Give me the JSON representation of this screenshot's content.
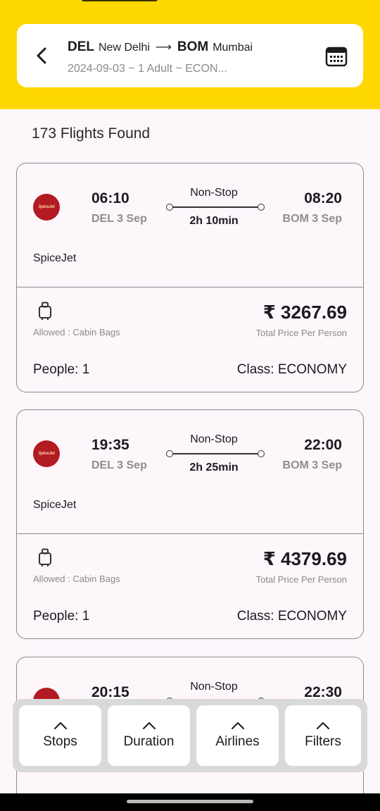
{
  "header": {
    "from_code": "DEL",
    "from_city": "New Delhi",
    "arrow": "⟶",
    "to_code": "BOM",
    "to_city": "Mumbai",
    "subtitle": "2024-09-03 ~ 1 Adult ~ ECON...",
    "back_icon": "chevron-left-icon",
    "calendar_icon": "calendar-icon"
  },
  "results": {
    "count_label": "173 Flights Found"
  },
  "flights": [
    {
      "dep_time": "06:10",
      "dep_sub": "DEL 3 Sep",
      "stops": "Non-Stop",
      "duration": "2h 10min",
      "arr_time": "08:20",
      "arr_sub": "BOM 3 Sep",
      "airline": "SpiceJet",
      "logo_text": "SpiceJet",
      "baggage": "Allowed : Cabin Bags",
      "price": "₹ 3267.69",
      "price_note": "Total Price Per Person",
      "people": "People: 1",
      "class": "Class: ECONOMY"
    },
    {
      "dep_time": "19:35",
      "dep_sub": "DEL 3 Sep",
      "stops": "Non-Stop",
      "duration": "2h 25min",
      "arr_time": "22:00",
      "arr_sub": "BOM 3 Sep",
      "airline": "SpiceJet",
      "logo_text": "SpiceJet",
      "baggage": "Allowed : Cabin Bags",
      "price": "₹ 4379.69",
      "price_note": "Total Price Per Person",
      "people": "People: 1",
      "class": "Class: ECONOMY"
    },
    {
      "dep_time": "20:15",
      "stops": "Non-Stop",
      "arr_time": "22:30"
    }
  ],
  "sort_bar": {
    "buttons": [
      {
        "label": "Stops",
        "icon": "chevron-up-icon"
      },
      {
        "label": "Duration",
        "icon": "chevron-up-icon"
      },
      {
        "label": "Airlines",
        "icon": "chevron-up-icon"
      },
      {
        "label": "Filters",
        "icon": "chevron-up-icon"
      }
    ]
  },
  "colors": {
    "header_yellow": "#fed700",
    "background": "#fdf6fb",
    "spicejet_red": "#b11b21",
    "card_border": "#8c8a8e"
  }
}
